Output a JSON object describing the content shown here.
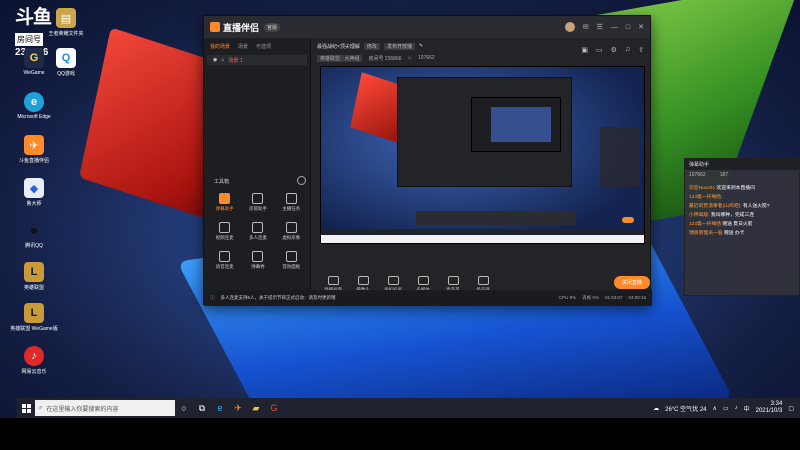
{
  "watermark": {
    "logo": "斗鱼",
    "room_label": "房间号",
    "room_id": "236866"
  },
  "desktop_icons": [
    {
      "label": "王者荣耀文件夹"
    },
    {
      "label": "WeGame"
    },
    {
      "label": "QQ游戏"
    },
    {
      "label": "Microsoft Edge"
    },
    {
      "label": "斗鱼直播伴侣"
    },
    {
      "label": "鲁大师"
    },
    {
      "label": "腾讯QQ"
    },
    {
      "label": "英雄联盟"
    },
    {
      "label": "英雄联盟 WeGame版"
    },
    {
      "label": "网易云音乐"
    }
  ],
  "taskbar": {
    "search_placeholder": "在这里输入你要搜索的内容",
    "weather": "26°C 空气优 24",
    "time": "3:34",
    "date": "2021/10/3"
  },
  "app": {
    "name": "直播伴侣",
    "version": "官版",
    "left_tabs": [
      "我的场景",
      "场景",
      "可选项"
    ],
    "scene_name": "场景 1",
    "tools_title": "工具箱",
    "tools": [
      {
        "label": "弹幕助手",
        "active": true
      },
      {
        "label": "房管助手",
        "active": false
      },
      {
        "label": "主播任务",
        "active": false
      },
      {
        "label": "视频连麦",
        "active": false
      },
      {
        "label": "多人连麦",
        "active": false
      },
      {
        "label": "虚拟形象",
        "active": false
      },
      {
        "label": "语音连麦",
        "active": false
      },
      {
        "label": "弹幕秀",
        "active": false
      },
      {
        "label": "音效面板",
        "active": false
      }
    ],
    "stream_title": "最强战纪×顶尖理解",
    "title_tag": "修改",
    "category": "发布开放播",
    "meta": {
      "room_tag": "英雄联盟 · 大神组",
      "room_id_label": "房间号 236866",
      "heat": "107662"
    },
    "controls": [
      {
        "label": "直播画面"
      },
      {
        "label": "摄像头"
      },
      {
        "label": "手机投屏"
      },
      {
        "label": "多媒体"
      },
      {
        "label": "麦克风"
      },
      {
        "label": "扬声器"
      }
    ],
    "go_live": "关闭直播",
    "notice": "多人连麦支持6人，关于提示节目正式启动：请及时更新哦",
    "stats": {
      "cpu": "CPU 9%",
      "frames": "丢帧 0%",
      "duration": "01:03:07",
      "total": "04:00:15"
    }
  },
  "chat": {
    "title": "弹幕助手",
    "viewers": "107662",
    "likes": "187",
    "messages": [
      {
        "who": "欢迎Nuxo01",
        "text": "欢迎来到本直播间"
      },
      {
        "who": "123第一纤绳哈:",
        "text": ""
      },
      {
        "who": "最近的荒漠拳者(山鸡吧):",
        "text": "有人送火箭?"
      },
      {
        "who": "小神毒敌:",
        "text": "我叫哪种，完成三连"
      },
      {
        "who": "123第一纤绳哈",
        "text": "赠送 夏日火箭"
      },
      {
        "who": "瑞恩管理员一般",
        "text": "赠送 办卡"
      }
    ]
  }
}
